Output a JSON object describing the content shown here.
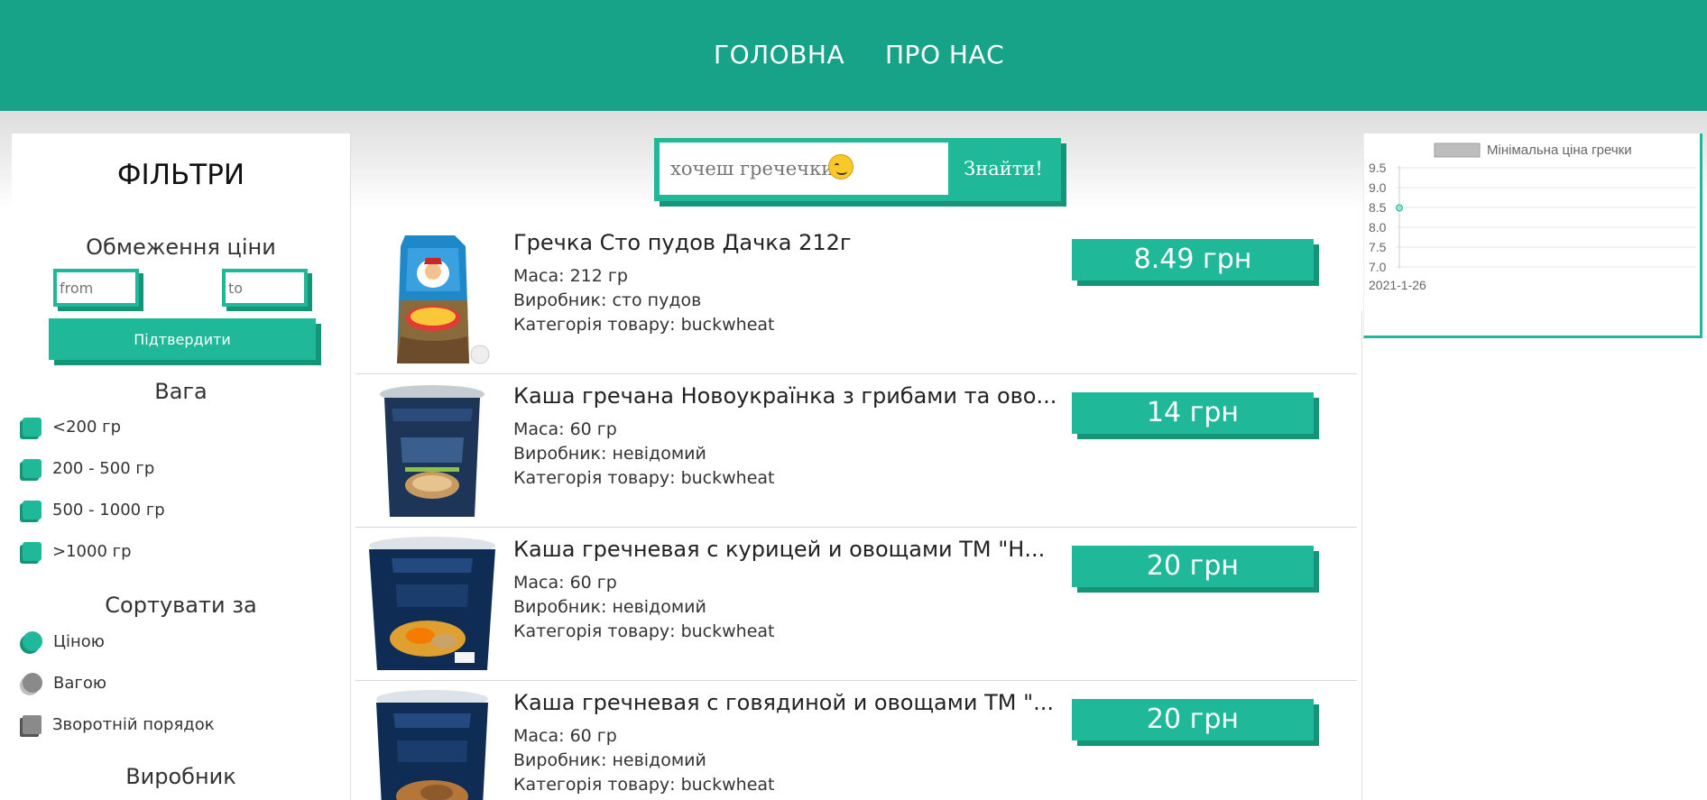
{
  "header": {
    "nav": [
      {
        "label": "ГОЛОВНА"
      },
      {
        "label": "ПРО НАС"
      }
    ]
  },
  "colors": {
    "accent": "#1fb898",
    "accent_dark": "#159478",
    "header_bg": "#17a387"
  },
  "sidebar": {
    "title": "ФІЛЬТРИ",
    "price_limit": {
      "title": "Обмеження ціни",
      "from_placeholder": "from",
      "to_placeholder": "to",
      "confirm_label": "Підтвердити"
    },
    "weight": {
      "title": "Вага",
      "options": [
        {
          "label": "<200 гр"
        },
        {
          "label": "200 - 500 гр"
        },
        {
          "label": "500 - 1000 гр"
        },
        {
          "label": ">1000 гр"
        }
      ]
    },
    "sort": {
      "title": "Сортувати за",
      "options": [
        {
          "label": "Ціною",
          "selected": true
        },
        {
          "label": "Вагою",
          "selected": false
        },
        {
          "label": "Зворотній порядок",
          "selected": false
        }
      ]
    },
    "producer": {
      "title": "Виробник"
    }
  },
  "search": {
    "placeholder": "хочеш гречечки?",
    "emoji": "smirk-emoji",
    "button_label": "Знайти!"
  },
  "products": [
    {
      "name": "Гречка Сто пудов Дачка 212г",
      "mass": "Маса: 212 гр",
      "producer": "Виробник: сто пудов",
      "category": "Категорія товару: buckwheat",
      "price": "8.49 грн"
    },
    {
      "name": "Каша гречана Новоукраїнка з грибами та ово...",
      "mass": "Маса: 60 гр",
      "producer": "Виробник: невідомий",
      "category": "Категорія товару: buckwheat",
      "price": "14 грн"
    },
    {
      "name": "Каша гречневая с курицей и овощами ТМ \"Н...",
      "mass": "Маса: 60 гр",
      "producer": "Виробник: невідомий",
      "category": "Категорія товару: buckwheat",
      "price": "20 грн"
    },
    {
      "name": "Каша гречневая с говядиной и овощами ТМ \"...",
      "mass": "Маса: 60 гр",
      "producer": "Виробник: невідомий",
      "category": "Категорія товару: buckwheat",
      "price": "20 грн"
    }
  ],
  "chart_data": {
    "type": "line",
    "legend": "Мінімальна ціна гречки",
    "legend_position": "top",
    "x": [
      "2021-1-26"
    ],
    "series": [
      {
        "name": "Мінімальна ціна гречки",
        "values": [
          8.49
        ]
      }
    ],
    "y_ticks": [
      "9.5",
      "9.0",
      "8.5",
      "8.0",
      "7.5",
      "7.0"
    ],
    "ylim": [
      7.0,
      9.5
    ],
    "grid": true
  }
}
